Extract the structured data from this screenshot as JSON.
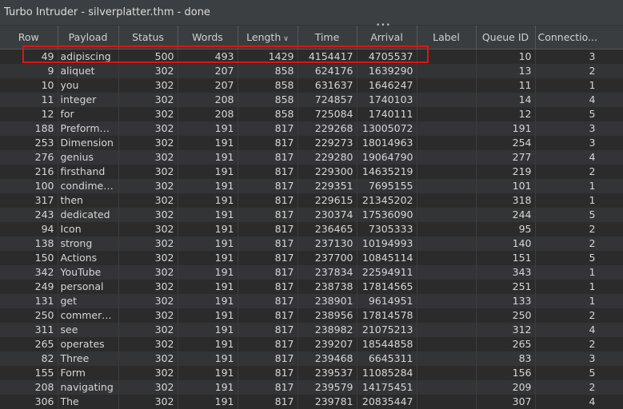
{
  "window": {
    "title": "Turbo Intruder - silverplatter.thm - done"
  },
  "table": {
    "columns": [
      "Row",
      "Payload",
      "Status",
      "Words",
      "Length",
      "Time",
      "Arrival",
      "Label",
      "Queue ID",
      "Connectio..."
    ],
    "sorted_column": "Length",
    "sort_direction": "descending",
    "highlight_color": "#e01414",
    "rows": [
      [
        "49",
        "adipiscing",
        "500",
        "493",
        "1429",
        "4154417",
        "4705537",
        "",
        "10",
        "3"
      ],
      [
        "9",
        "aliquet",
        "302",
        "207",
        "858",
        "624176",
        "1639290",
        "",
        "13",
        "2"
      ],
      [
        "10",
        "you",
        "302",
        "207",
        "858",
        "631637",
        "1646247",
        "",
        "11",
        "1"
      ],
      [
        "11",
        "integer",
        "302",
        "208",
        "858",
        "724857",
        "1740103",
        "",
        "14",
        "4"
      ],
      [
        "12",
        "for",
        "302",
        "208",
        "858",
        "725084",
        "1740111",
        "",
        "12",
        "5"
      ],
      [
        "188",
        "Preformat...",
        "302",
        "191",
        "817",
        "229268",
        "13005072",
        "",
        "191",
        "3"
      ],
      [
        "253",
        "Dimension",
        "302",
        "191",
        "817",
        "229273",
        "18014963",
        "",
        "254",
        "3"
      ],
      [
        "276",
        "genius",
        "302",
        "191",
        "817",
        "229280",
        "19064790",
        "",
        "277",
        "4"
      ],
      [
        "216",
        "firsthand",
        "302",
        "191",
        "817",
        "229300",
        "14635219",
        "",
        "219",
        "2"
      ],
      [
        "100",
        "condimen...",
        "302",
        "191",
        "817",
        "229351",
        "7695155",
        "",
        "101",
        "1"
      ],
      [
        "317",
        "then",
        "302",
        "191",
        "817",
        "229615",
        "21345202",
        "",
        "318",
        "1"
      ],
      [
        "243",
        "dedicated",
        "302",
        "191",
        "817",
        "230374",
        "17536090",
        "",
        "244",
        "5"
      ],
      [
        "94",
        "Icon",
        "302",
        "191",
        "817",
        "236465",
        "7305333",
        "",
        "95",
        "2"
      ],
      [
        "138",
        "strong",
        "302",
        "191",
        "817",
        "237130",
        "10194993",
        "",
        "140",
        "2"
      ],
      [
        "150",
        "Actions",
        "302",
        "191",
        "817",
        "237700",
        "10845114",
        "",
        "151",
        "5"
      ],
      [
        "342",
        "YouTube",
        "302",
        "191",
        "817",
        "237834",
        "22594911",
        "",
        "343",
        "1"
      ],
      [
        "249",
        "personal",
        "302",
        "191",
        "817",
        "238738",
        "17814565",
        "",
        "251",
        "1"
      ],
      [
        "131",
        "get",
        "302",
        "191",
        "817",
        "238901",
        "9614951",
        "",
        "133",
        "1"
      ],
      [
        "250",
        "commercial",
        "302",
        "191",
        "817",
        "238956",
        "17814578",
        "",
        "250",
        "2"
      ],
      [
        "311",
        "see",
        "302",
        "191",
        "817",
        "238982",
        "21075213",
        "",
        "312",
        "4"
      ],
      [
        "265",
        "operates",
        "302",
        "191",
        "817",
        "239207",
        "18544858",
        "",
        "265",
        "2"
      ],
      [
        "82",
        "Three",
        "302",
        "191",
        "817",
        "239468",
        "6645311",
        "",
        "83",
        "3"
      ],
      [
        "155",
        "Form",
        "302",
        "191",
        "817",
        "239537",
        "11085284",
        "",
        "156",
        "5"
      ],
      [
        "208",
        "navigating",
        "302",
        "191",
        "817",
        "239579",
        "14175451",
        "",
        "209",
        "2"
      ],
      [
        "306",
        "The",
        "302",
        "191",
        "817",
        "239781",
        "20835447",
        "",
        "307",
        "4"
      ]
    ]
  }
}
